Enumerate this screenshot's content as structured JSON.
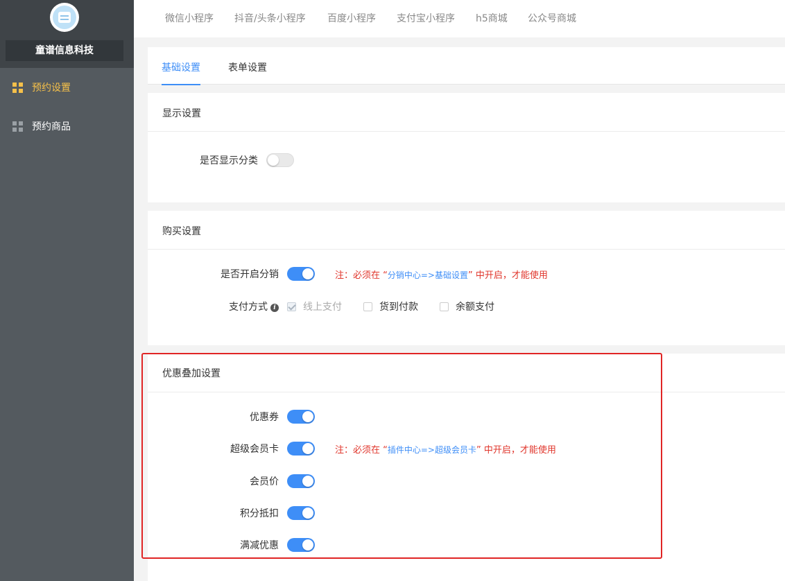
{
  "app": {
    "company_name": "童谱信息科技"
  },
  "sidebar": {
    "items": [
      {
        "label": "预约设置",
        "active": true
      },
      {
        "label": "预约商品",
        "active": false
      }
    ]
  },
  "top_tabs": [
    "微信小程序",
    "抖音/头条小程序",
    "百度小程序",
    "支付宝小程序",
    "h5商城",
    "公众号商城"
  ],
  "sub_tabs": [
    {
      "label": "基础设置",
      "active": true
    },
    {
      "label": "表单设置",
      "active": false
    }
  ],
  "display_section": {
    "title": "显示设置",
    "show_category_label": "是否显示分类",
    "show_category_on": false
  },
  "purchase_section": {
    "title": "购买设置",
    "distribution_label": "是否开启分销",
    "distribution_on": true,
    "distribution_note_prefix": "注：必须在 “",
    "distribution_note_link": "分销中心=>基础设置",
    "distribution_note_suffix": "” 中开启，才能使用",
    "payment_label": "支付方式",
    "payment_options": [
      {
        "label": "线上支付",
        "checked": true,
        "disabled": true
      },
      {
        "label": "货到付款",
        "checked": false,
        "disabled": false
      },
      {
        "label": "余额支付",
        "checked": false,
        "disabled": false
      }
    ]
  },
  "discount_section": {
    "title": "优惠叠加设置",
    "rows": [
      {
        "label": "优惠券",
        "on": true
      },
      {
        "label": "超级会员卡",
        "on": true
      },
      {
        "label": "会员价",
        "on": true
      },
      {
        "label": "积分抵扣",
        "on": true
      },
      {
        "label": "满减优惠",
        "on": true
      }
    ],
    "vip_note_prefix": "注：必须在 “",
    "vip_note_link": "插件中心=>超级会员卡",
    "vip_note_suffix": "” 中开启，才能使用"
  },
  "colors": {
    "accent": "#3e8ef7",
    "warning": "#e0352b",
    "sidebar_active": "#f5c04a",
    "highlight_border": "#e02424"
  }
}
